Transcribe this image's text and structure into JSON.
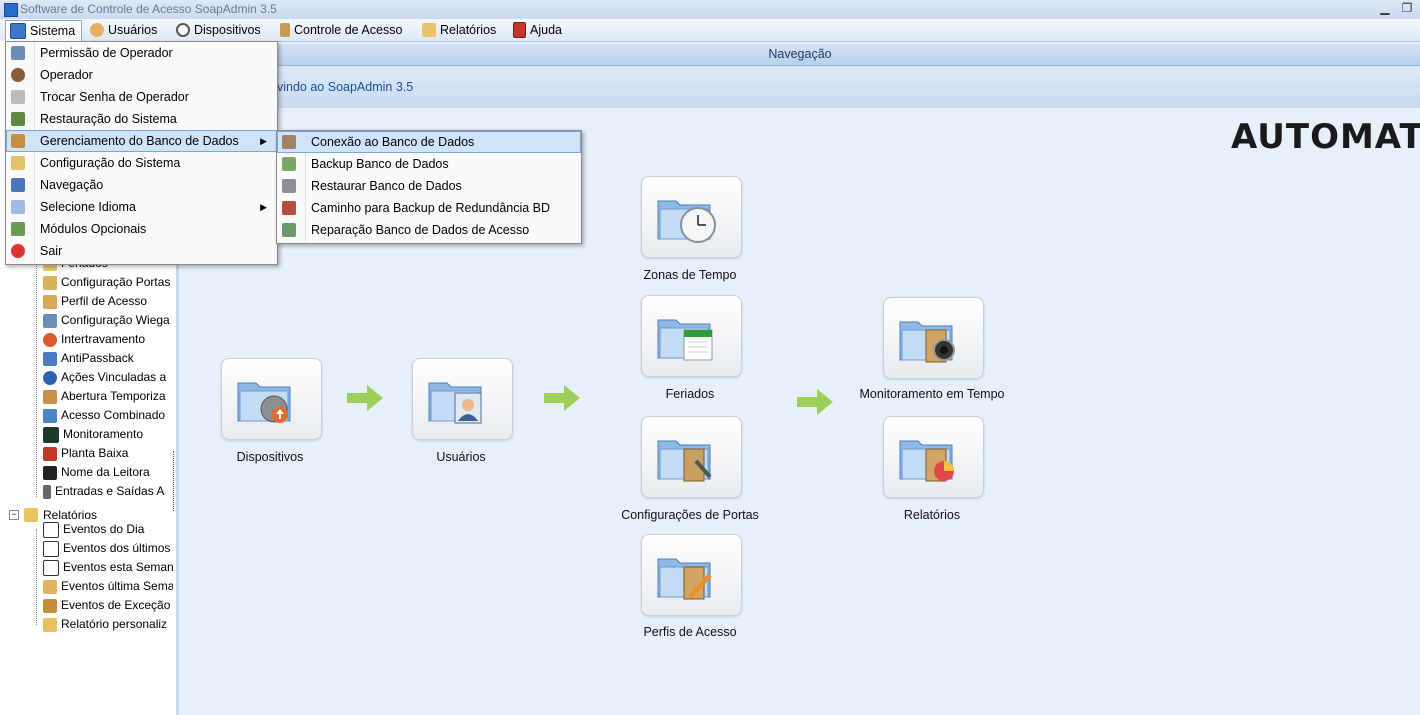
{
  "window": {
    "title": "Software de Controle de Acesso SoapAdmin 3.5"
  },
  "menubar": {
    "items": [
      {
        "label": "Sistema",
        "icon": "monitor-icon"
      },
      {
        "label": "Usuários",
        "icon": "users-icon"
      },
      {
        "label": "Dispositivos",
        "icon": "gear-icon"
      },
      {
        "label": "Controle de Acesso",
        "icon": "access-icon"
      },
      {
        "label": "Relatórios",
        "icon": "reports-icon"
      },
      {
        "label": "Ajuda",
        "icon": "help-book-icon"
      }
    ]
  },
  "system_menu": {
    "items": [
      {
        "label": "Permissão de Operador",
        "icon": "operator-permission-icon"
      },
      {
        "label": "Operador",
        "icon": "operator-icon"
      },
      {
        "label": "Trocar Senha de Operador",
        "icon": "password-icon"
      },
      {
        "label": "Restauração do Sistema",
        "icon": "restore-icon"
      },
      {
        "label": "Gerenciamento do Banco de Dados",
        "icon": "database-icon"
      },
      {
        "label": "Configuração do Sistema",
        "icon": "settings-icon"
      },
      {
        "label": "Navegação",
        "icon": "navigation-icon"
      },
      {
        "label": "Selecione Idioma",
        "icon": "language-icon"
      },
      {
        "label": "Módulos Opcionais",
        "icon": "modules-icon"
      },
      {
        "label": "Sair",
        "icon": "exit-icon"
      }
    ]
  },
  "db_submenu": {
    "items": [
      {
        "label": "Conexão ao Banco de Dados",
        "icon": "db-connection-icon"
      },
      {
        "label": "Backup Banco de Dados",
        "icon": "db-backup-icon"
      },
      {
        "label": "Restaurar Banco de Dados",
        "icon": "db-restore-icon"
      },
      {
        "label": "Caminho para Backup de Redundância BD",
        "icon": "db-path-icon"
      },
      {
        "label": "Reparação Banco de Dados de Acesso",
        "icon": "db-repair-icon"
      }
    ]
  },
  "nav": {
    "header": "Navegação",
    "welcome": "vindo ao SoapAdmin 3.5",
    "logo": "AUTOMATIZA"
  },
  "tree": {
    "items": [
      {
        "label": "Feriados"
      },
      {
        "label": "Configuração Portas"
      },
      {
        "label": "Perfil de Acesso"
      },
      {
        "label": "Configuração Wiega"
      },
      {
        "label": "Intertravamento"
      },
      {
        "label": "AntiPassback"
      },
      {
        "label": "Ações Vinculadas a"
      },
      {
        "label": "Abertura Temporiza"
      },
      {
        "label": "Acesso Combinado"
      },
      {
        "label": "Monitoramento"
      },
      {
        "label": "Planta Baixa"
      },
      {
        "label": "Nome da Leitora"
      },
      {
        "label": "Entradas e Saídas A"
      }
    ],
    "reports_group": "Relatórios",
    "reports": [
      {
        "label": "Eventos do Dia"
      },
      {
        "label": "Eventos dos últimos"
      },
      {
        "label": "Eventos esta Seman"
      },
      {
        "label": "Eventos última Sema"
      },
      {
        "label": "Eventos de Exceção"
      },
      {
        "label": "Relatório personaliz"
      }
    ]
  },
  "tiles": {
    "dispositivos": "Dispositivos",
    "usuarios": "Usuários",
    "zonas": "Zonas de Tempo",
    "feriados": "Feriados",
    "portas": "Configurações  de  Portas",
    "perfis": "Perfis de Acesso",
    "monitoramento": "Monitoramento em Tempo",
    "relatorios": "Relatórios"
  }
}
